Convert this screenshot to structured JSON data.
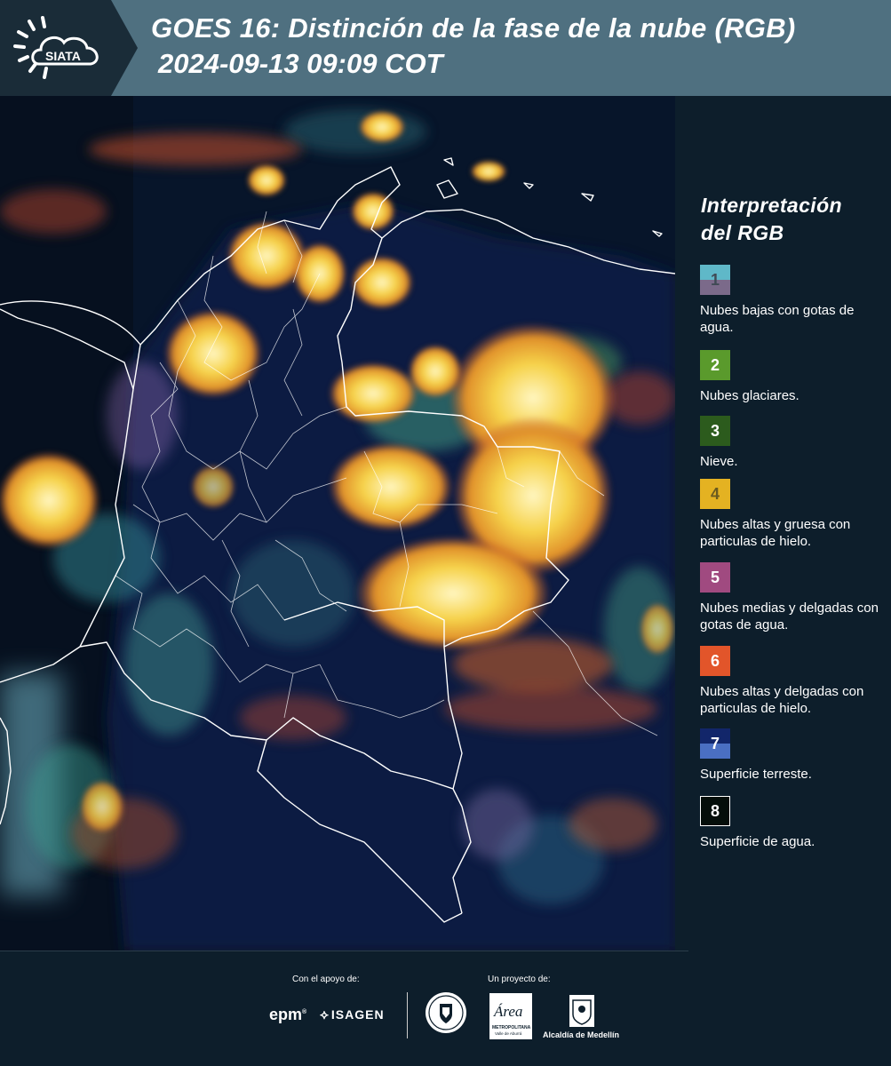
{
  "header": {
    "logo_text": "SIATA",
    "title_line1": "GOES 16: Distinción de la fase de la nube (RGB)",
    "title_line2": "2024-09-13 09:09 COT"
  },
  "legend": {
    "title_line1": "Interpretación",
    "title_line2": "del RGB",
    "items": [
      {
        "number": "1",
        "label": "Nubes bajas con gotas de agua.",
        "color_top": "#5fb8c8",
        "color_bottom": "#7b6a8a",
        "text_color": "#404a55"
      },
      {
        "number": "2",
        "label": "Nubes glaciares.",
        "color_top": "#5a9a2c",
        "color_bottom": "#5a9a2c",
        "text_color": "#ffffff"
      },
      {
        "number": "3",
        "label": "Nieve.",
        "color_top": "#2c5b1d",
        "color_bottom": "#2c5b1d",
        "text_color": "#ffffff"
      },
      {
        "number": "4",
        "label": "Nubes altas y gruesa con particulas de hielo.",
        "color_top": "#e4b222",
        "color_bottom": "#e4b222",
        "text_color": "#6a5a20"
      },
      {
        "number": "5",
        "label": "Nubes medias y delgadas con gotas de agua.",
        "color_top": "#a04a80",
        "color_bottom": "#a04a80",
        "text_color": "#ffffff"
      },
      {
        "number": "6",
        "label": "Nubes altas y delgadas con particulas de hielo.",
        "color_top": "#e2552a",
        "color_bottom": "#e2552a",
        "text_color": "#ffffff"
      },
      {
        "number": "7",
        "label": "Superficie terreste.",
        "color_top": "#12266a",
        "color_bottom": "#4a6fc2",
        "text_color": "#ffffff"
      },
      {
        "number": "8",
        "label": "Superficie de agua.",
        "color_top": "#050e0a",
        "color_bottom": "#050e0a",
        "text_color": "#ffffff"
      }
    ]
  },
  "footer": {
    "support_caption": "Con el apoyo de:",
    "project_caption": "Un proyecto de:",
    "epm": "epm",
    "isagen": "ISAGEN",
    "area_word": "Área",
    "area_sub": "METROPOLITANA",
    "area_sub2": "Valle de Aburrá",
    "alcaldia": "Alcaldía de Medellín"
  }
}
